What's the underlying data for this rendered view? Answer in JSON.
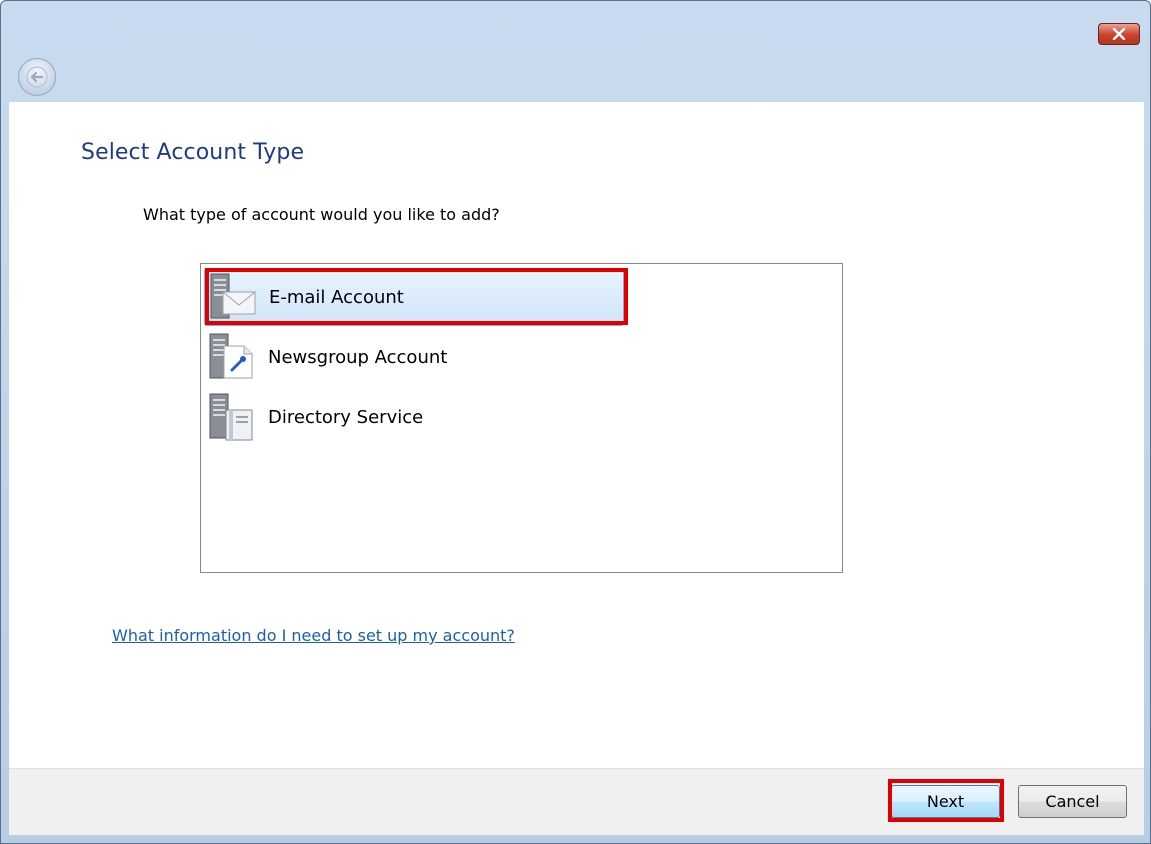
{
  "window": {
    "close_icon": "close-icon",
    "back_icon": "back-arrow-icon"
  },
  "page": {
    "title": "Select Account Type",
    "question": "What type of account would you like to add?"
  },
  "account_types": [
    {
      "label": "E-mail Account",
      "icon": "email-server-icon",
      "selected": true
    },
    {
      "label": "Newsgroup Account",
      "icon": "newsgroup-server-icon",
      "selected": false
    },
    {
      "label": "Directory Service",
      "icon": "directory-server-icon",
      "selected": false
    }
  ],
  "help_link": "What information do I need to set up my account?",
  "buttons": {
    "next": "Next",
    "cancel": "Cancel"
  },
  "colors": {
    "title": "#1e3a8a",
    "link": "#1a5fb4",
    "highlight": "#e00000",
    "selection": "#cfe5fa"
  }
}
